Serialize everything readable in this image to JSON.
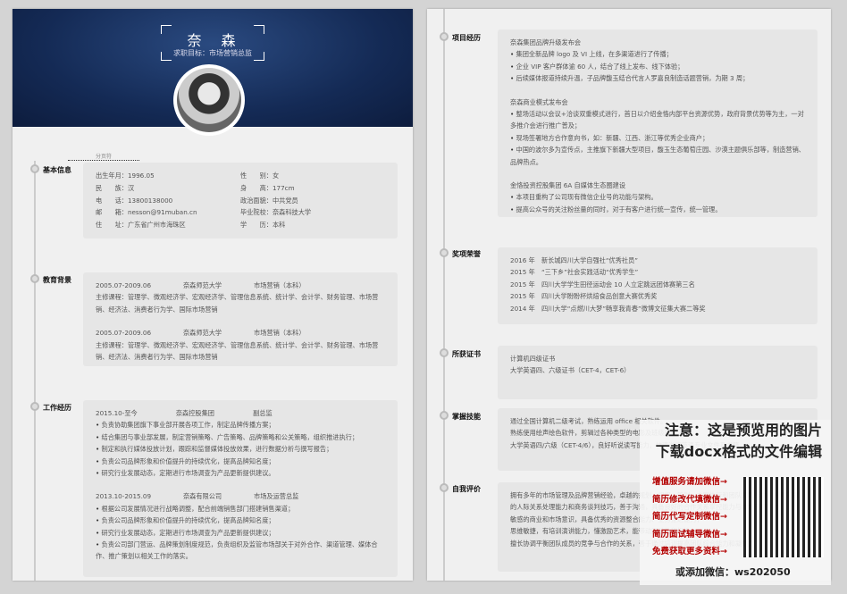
{
  "header": {
    "name": "奈　森",
    "objective": "求职目标：市场营销总监",
    "page_break": "分页符"
  },
  "basic": {
    "title": "基本信息",
    "items": [
      "出生年月：1996.05",
      "性　　别：女",
      "民　　族：汉",
      "身　　高：177cm",
      "电　　话：13800138000",
      "政治面貌：中共党员",
      "邮　　箱：nesson@91muban.cn",
      "毕业院校：奈森科技大学",
      "住　　址：广东省广州市海珠区",
      "学　　历：本科"
    ]
  },
  "education": {
    "title": "教育背景",
    "lines": [
      "2005.07-2009.06　　　　　奈森师范大学　　　　　市场营销（本科）",
      "主修课程：管理学、微观经济学、宏观经济学、管理信息系统、统计学、会计学、财务管理、市场营销、经济法、消费者行为学、国际市场营销",
      "",
      "2005.07-2009.06　　　　　奈森师范大学　　　　　市场营销（本科）",
      "主修课程：管理学、微观经济学、宏观经济学、管理信息系统、统计学、会计学、财务管理、市场营销、经济法、消费者行为学、国际市场营销"
    ]
  },
  "work": {
    "title": "工作经历",
    "lines": [
      "2015.10-至今　　　　　　奈森控股集团　　　　　　副总监",
      "•负责协助集团旗下事业部开展各项工作，制定品牌传播方案；",
      "•结合集团与事业部发展，制定营销策略、广告策略、品牌策略和公关策略，组织推进执行；",
      "•制定和执行媒体投放计划，跟踪和监督媒体投放效果，进行数据分析与撰写报告；",
      "•负责公司品牌形象和价值提升的持续优化，提高品牌知名度；",
      "•研究行业发展动态，定期进行市场调查为产品更新提供建议。",
      "",
      "2013.10-2015.09　　　　　奈森有限公司　　　　　市场及运营总监",
      "•根据公司发展情况进行战略调整，配合前端销售部门搭建销售渠道；",
      "•负责公司品牌形象和价值提升的持续优化，提高品牌知名度；",
      "•研究行业发展动态，定期进行市场调查为产品更新提供建议；",
      "•负责公司部门营运、品牌策划制度规范，负责组织及监管市场部关于对外合作、渠道管理、媒体合作、推广策划以相关工作的落实。"
    ]
  },
  "projects": {
    "title": "项目经历",
    "lines": [
      "奈森集团品牌升级发布会",
      "•集团全新品牌 logo 及 VI 上线，在多渠道进行了传播；",
      "•企业 VIP 客户群体逾 60 人，结合了线上发布、线下体验；",
      "•后续媒体报道持续升温，子品牌馥玉结合代言人罗嘉良制造话题营销，为期 3 周；",
      "",
      "奈森商业模式发布会",
      "•整场活动以会议+洽谈双重模式进行，首日以介绍金恪内部平台资源优势，政府背景优势等为主，一对多推介会进行推广普及；",
      "•现场签署地方合作意向书，如：新疆、江西、浙江等优秀企业商户；",
      "•中国的波尔多为宣传点，主推旗下新疆大型项目，馥玉生态葡萄庄园、沙漠主题俱乐部等，制造营销、品牌热点。",
      "",
      "金恪投资控股集团 6A 自媒体生态圈建设",
      "•本项目重构了公司现有微信企业号的功能与架构。",
      "•提高公众号的关注粉丝量的同时，对于有客户进行统一宣传，统一管理。"
    ]
  },
  "awards": {
    "title": "奖项荣誉",
    "lines": [
      "2016 年　新长城四川大学自强社“优秀社员”",
      "2015 年　“三下乡”社会实践活动“优秀学生”",
      "2015 年　四川大学学生田径运动会 10 人立定跳远团体赛第三名",
      "2015 年　四川大学盼盼杯烘焙食品创意大赛优秀奖",
      "2014 年　四川大学“点燃川大梦”畅享我青春”微博文征集大赛二等奖"
    ]
  },
  "certs": {
    "title": "所获证书",
    "lines": [
      "计算机四级证书",
      "大学英语四、六级证书（CET-4，CET-6）"
    ]
  },
  "skills": {
    "title": "掌握技能",
    "lines": [
      "通过全国计算机二级考试，熟练运用 office 相关软件。",
      "熟练使用绘声绘色软件，剪辑过各种类型的电影及班级视频。",
      "大学英语四/六级（CET-4/6），良好听说读写能力，快速浏览英语专业文件及书籍。"
    ]
  },
  "self": {
    "title": "自我评价",
    "lines": [
      "拥有多年的市场管理及品牌营销经验，卓越的规划、组织、策划、方案执行和团队领导能力，积累较强的人际关系处理能力和商务谈判技巧，善于沟通，具备良好的合作关系掌控能力与市场开拓能力；",
      "敏感的商业和市场意识，具备优秀的资源整合能力、业务推进能力；",
      "思维敏捷，有培训演讲能力，懂激励艺术，能带动团队的积极性；",
      "擅长协调平衡团队成员的竞争与合作的关系，善于通过培训提高团队综合能力和凝聚力。"
    ]
  },
  "watermark": {
    "line1": "注意：这是预览用的图片",
    "line2": "下载docx格式的文件编辑",
    "links": [
      "增值服务请加微信→",
      "简历修改代填微信→",
      "简历代写定制微信→",
      "简历面试辅导微信→",
      "免费获取更多资料→"
    ],
    "wechat": "或添加微信：ws202050"
  }
}
